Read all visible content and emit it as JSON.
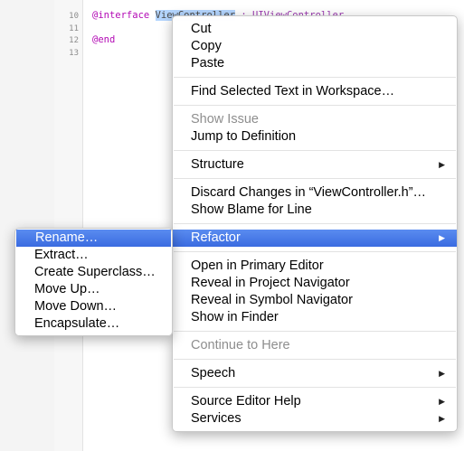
{
  "editor": {
    "line_numbers": [
      "10",
      "11",
      "12",
      "13"
    ],
    "code": {
      "interface_keyword": "@interface",
      "class_name": "ViewController",
      "rest": " : UIViewController",
      "end_keyword": "@end"
    }
  },
  "context_menu": {
    "items": {
      "cut": "Cut",
      "copy": "Copy",
      "paste": "Paste",
      "find_selected": "Find Selected Text in Workspace…",
      "show_issue": "Show Issue",
      "jump_to_definition": "Jump to Definition",
      "structure": "Structure",
      "discard_changes": "Discard Changes in “ViewController.h”…",
      "show_blame": "Show Blame for Line",
      "refactor": "Refactor",
      "open_primary": "Open in Primary Editor",
      "reveal_project": "Reveal in Project Navigator",
      "reveal_symbol": "Reveal in Symbol Navigator",
      "show_finder": "Show in Finder",
      "continue_here": "Continue to Here",
      "speech": "Speech",
      "source_editor_help": "Source Editor Help",
      "services": "Services"
    },
    "submenu_arrow": "▶"
  },
  "refactor_submenu": {
    "items": {
      "rename": "Rename…",
      "extract": "Extract…",
      "create_superclass": "Create Superclass…",
      "move_up": "Move Up…",
      "move_down": "Move Down…",
      "encapsulate": "Encapsulate…"
    }
  },
  "colors": {
    "highlight": "#3a6be0",
    "keyword": "#b30ab5",
    "selection": "#b4d5fe"
  }
}
